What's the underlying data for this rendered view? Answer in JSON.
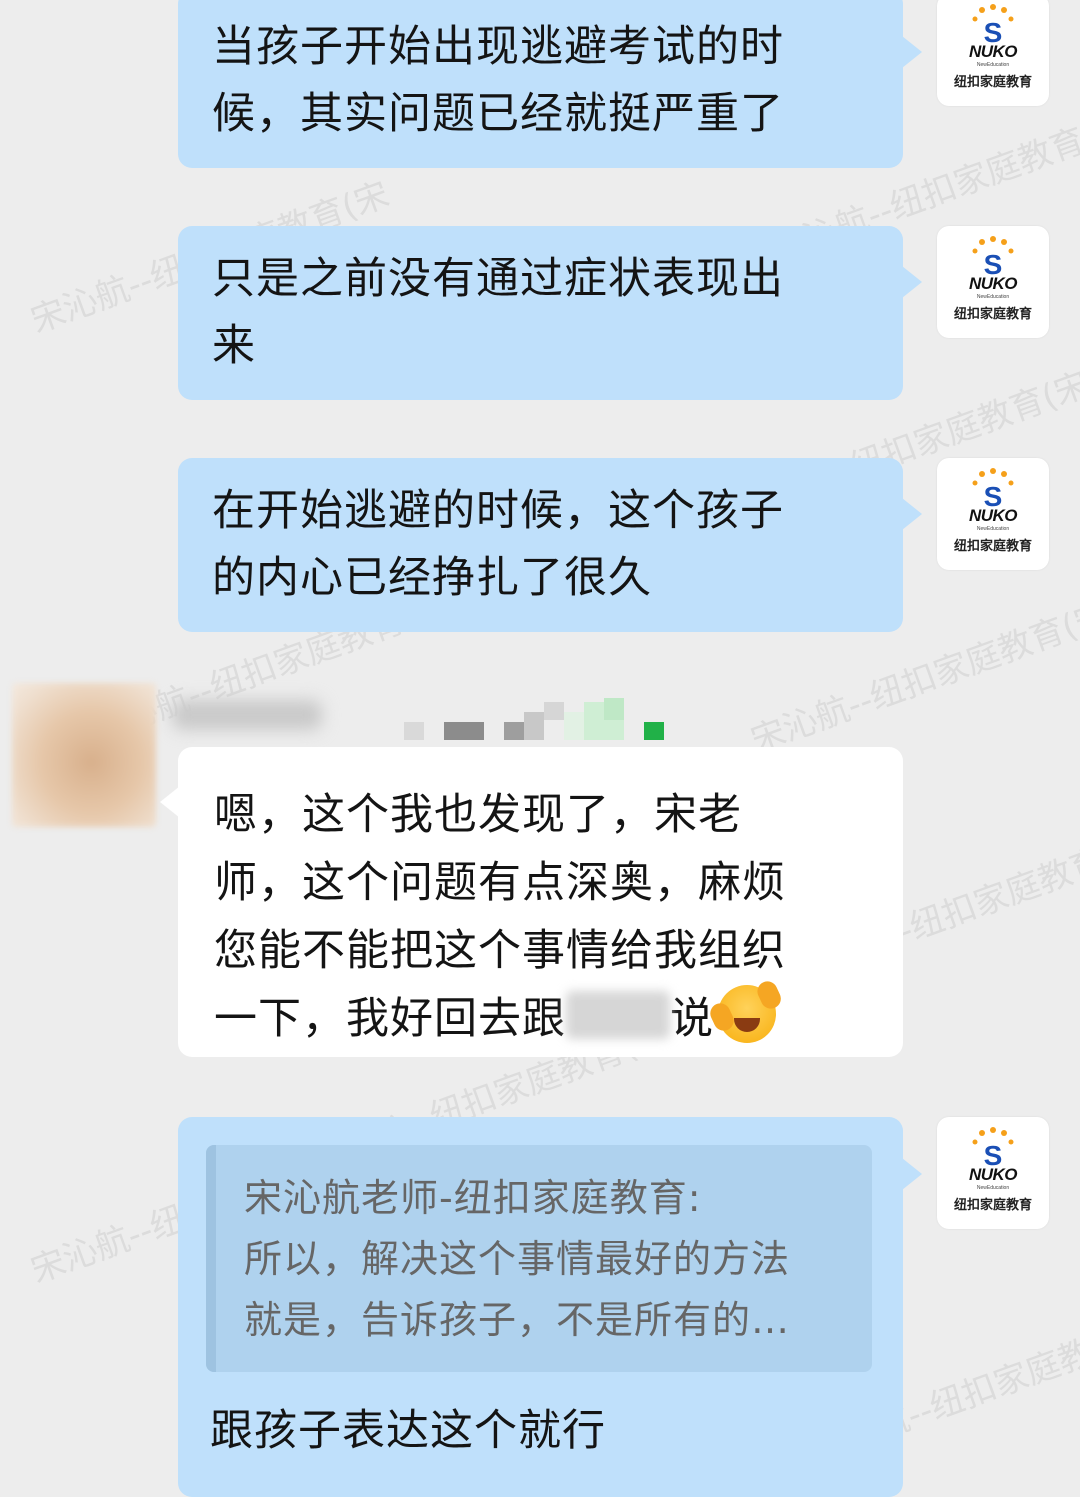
{
  "watermark": "宋沁航--纽扣家庭教育(宋",
  "logo": {
    "brand": "NUKO",
    "tagline": "NewEducation",
    "cn": "纽扣家庭教育"
  },
  "messages": {
    "m1": {
      "line1": "当孩子开始出现逃避考试的时",
      "line2": "候，其实问题已经就挺严重了"
    },
    "m2": {
      "line1": "只是之前没有通过症状表现出",
      "line2": "来"
    },
    "m3": {
      "line1": "在开始逃避的时候，这个孩子",
      "line2": "的内心已经挣扎了很久"
    },
    "m4": {
      "line1": "嗯，这个我也发现了，宋老",
      "line2": "师，这个问题有点深奥，麻烦",
      "line3": "您能不能把这个事情给我组织",
      "line4_a": "一下，我好回去跟",
      "line4_b": "说"
    },
    "m5": {
      "quote_author": "宋沁航老师-纽扣家庭教育:",
      "quote_line1": "所以，解决这个事情最好的方法",
      "quote_line2": "就是，告诉孩子，不是所有的…",
      "reply": "跟孩子表达这个就行"
    }
  },
  "colors": {
    "outgoing_bubble": "#bfe0fb",
    "incoming_bubble": "#ffffff",
    "background": "#ededed"
  }
}
